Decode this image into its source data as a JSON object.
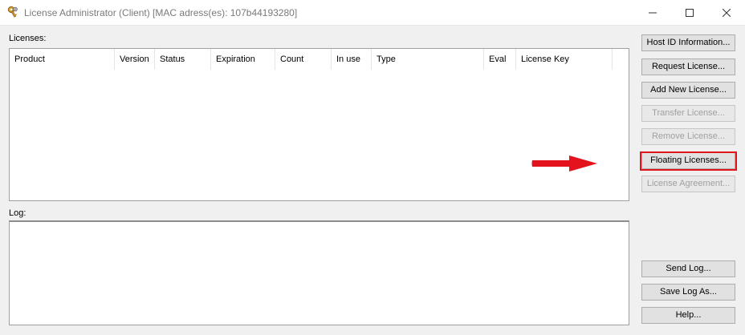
{
  "window": {
    "title": "License Administrator (Client) [MAC adress(es): 107b44193280]",
    "minimize_glyph": "—",
    "maximize_glyph": "☐",
    "close_glyph": "✕"
  },
  "licenses": {
    "label": "Licenses:",
    "columns": [
      "Product",
      "Version",
      "Status",
      "Expiration",
      "Count",
      "In use",
      "Type",
      "Eval",
      "License Key"
    ],
    "rows": []
  },
  "log": {
    "label": "Log:",
    "content": ""
  },
  "buttons": {
    "host_id": "Host ID Information...",
    "request_license": "Request License...",
    "add_new_license": "Add New License...",
    "transfer_license": "Transfer License...",
    "remove_license": "Remove License...",
    "floating_licenses": "Floating Licenses...",
    "license_agreement": "License Agreement...",
    "send_log": "Send Log...",
    "save_log_as": "Save Log As...",
    "help": "Help..."
  },
  "colors": {
    "highlight": "#e3131e",
    "arrow": "#e3131e",
    "disabled_text": "#a0a0a0"
  },
  "icons": {
    "app": "keys-icon",
    "annotation": "red-arrow-icon"
  }
}
